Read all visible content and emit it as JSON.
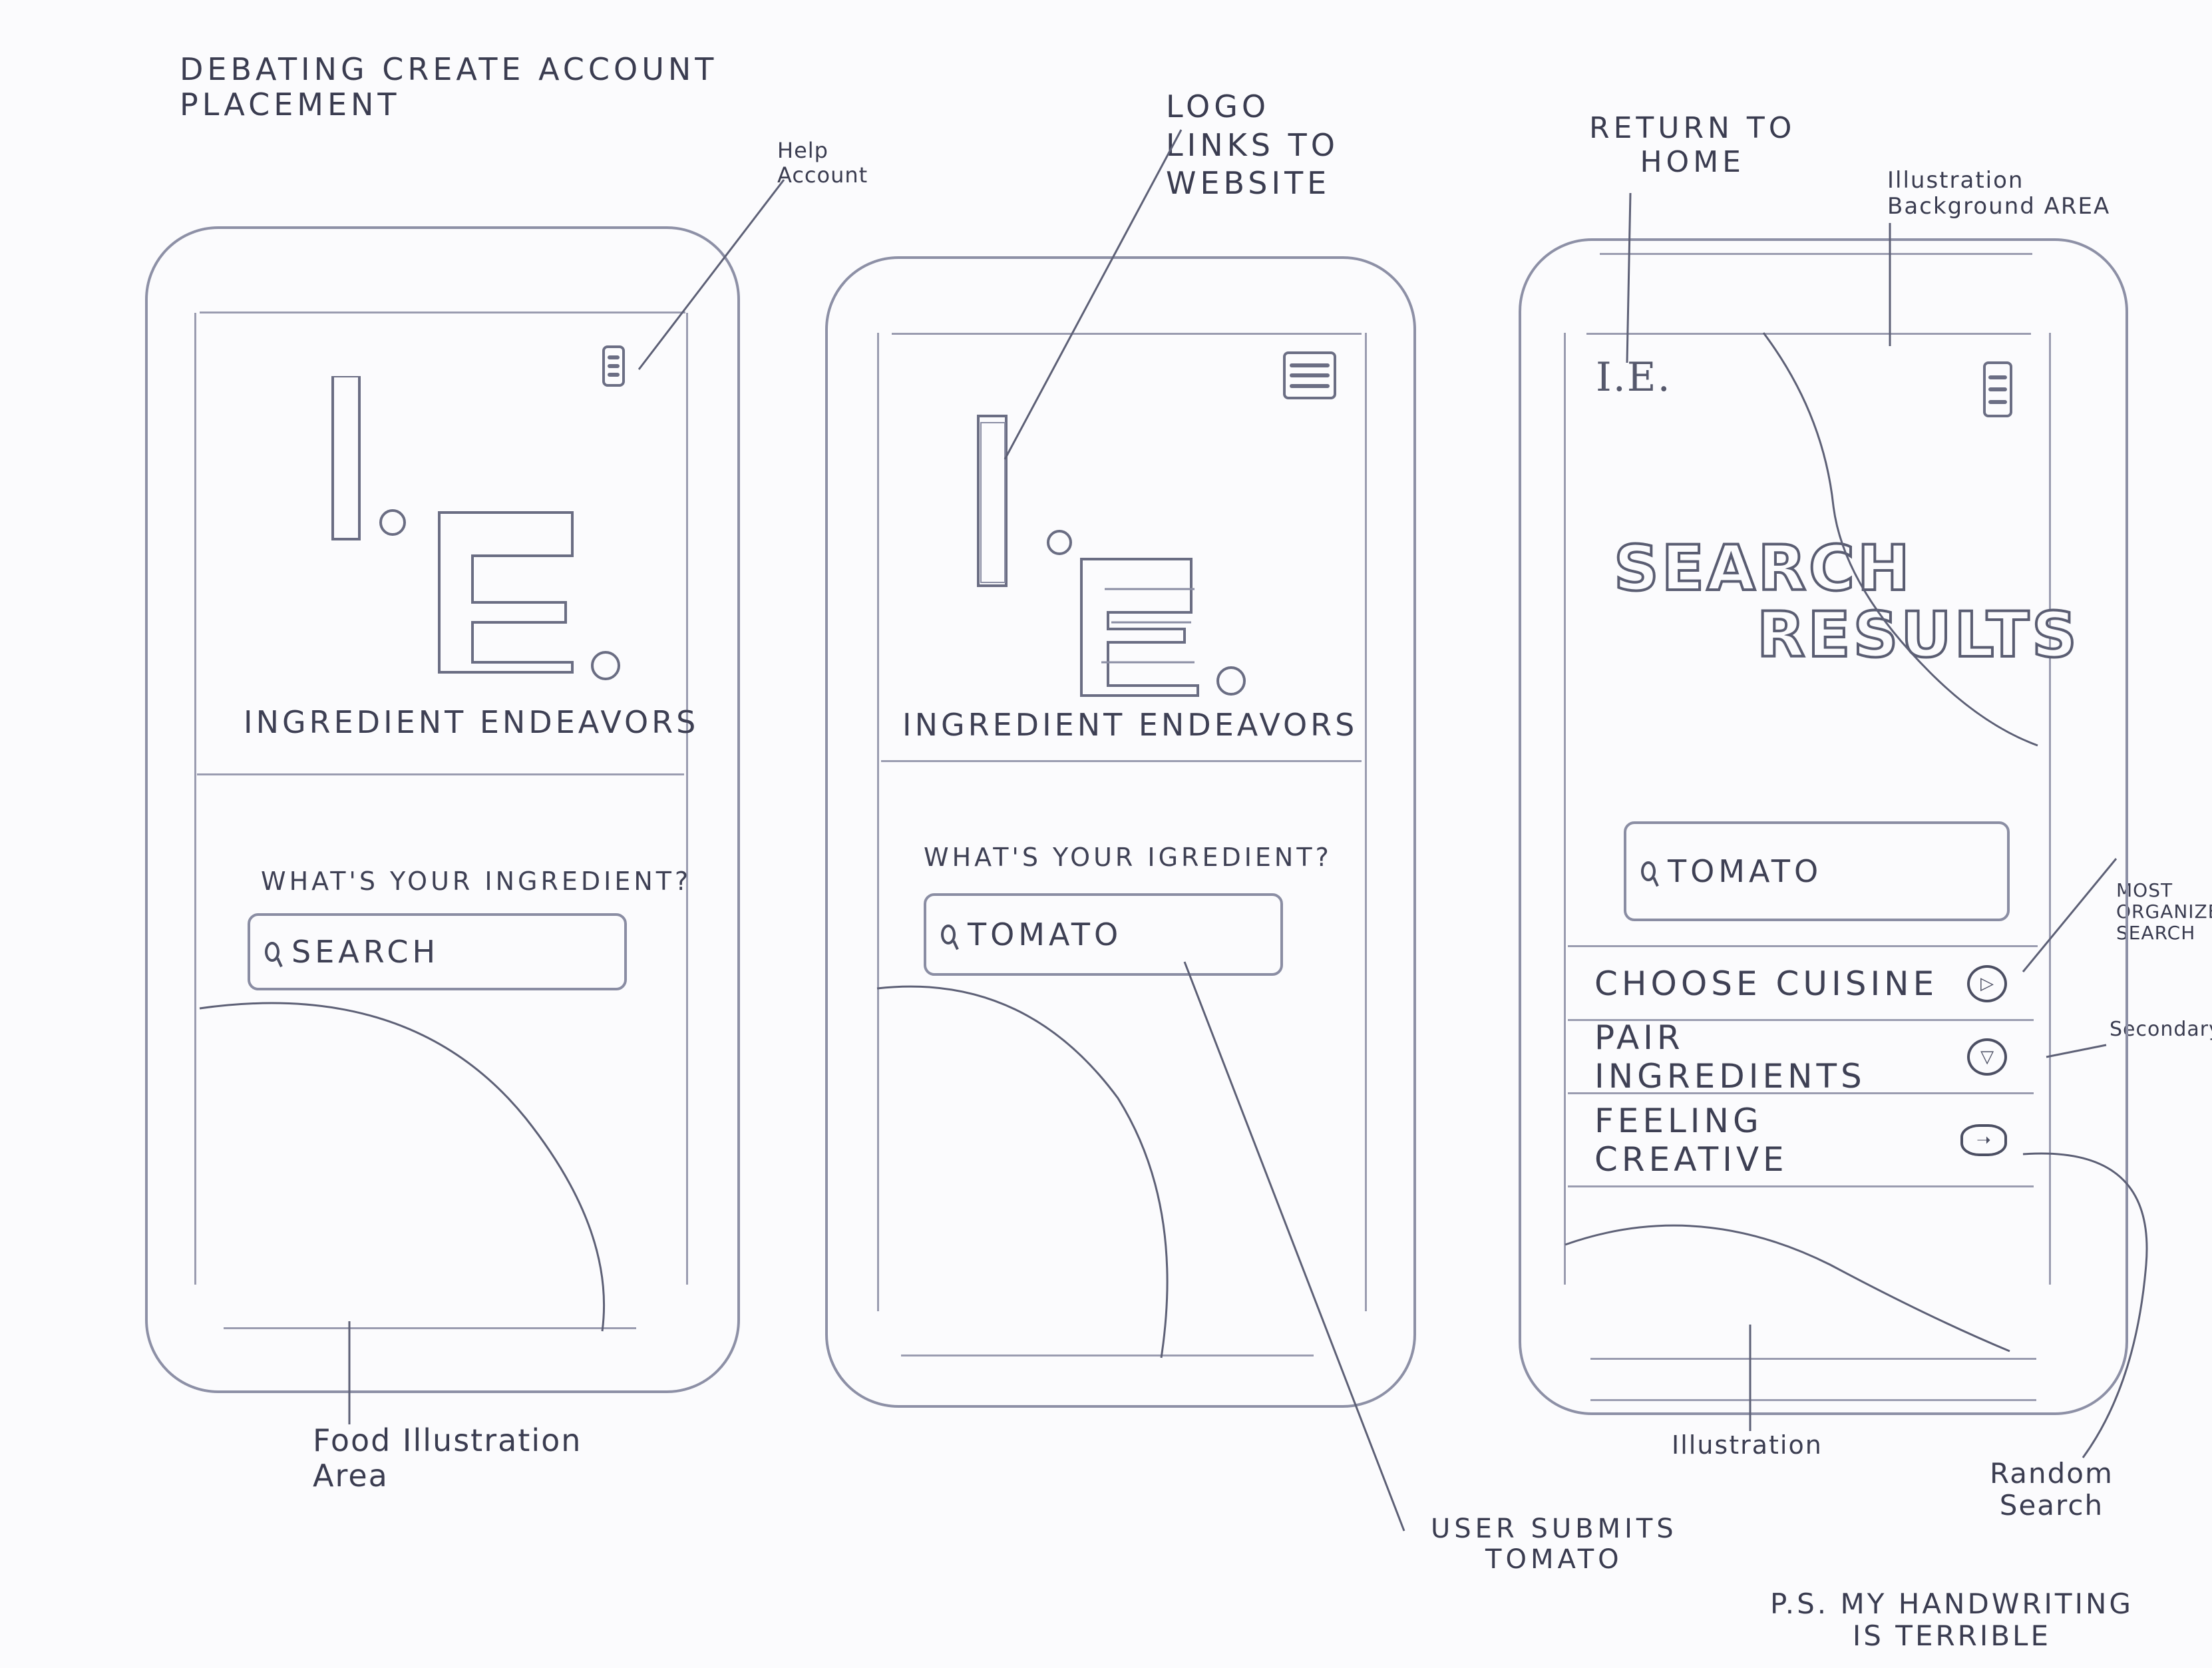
{
  "annotations": {
    "create_account": "DEBATING CREATE ACCOUNT\nPLACEMENT",
    "help_account": "Help\nAccount",
    "logo_links": "LOGO\nLINKS TO\nWEBSITE",
    "return_home": "RETURN TO\nHOME",
    "illustration_background": "Illustration\nBackground AREA",
    "food_illustration": "Food Illustration\nArea",
    "user_submits": "USER SUBMITS\nTOMATO",
    "most_organized": "MOST\nORGANIZED\nSEARCH",
    "secondary": "Secondary",
    "illustration": "Illustration",
    "random_search": "Random\nSearch",
    "ps_note": "P.S. MY HANDWRITING\nIS TERRIBLE"
  },
  "screen1": {
    "logo_text": "INGREDIENT ENDEAVORS",
    "prompt": "WHAT'S YOUR INGREDIENT?",
    "search_placeholder": "SEARCH"
  },
  "screen2": {
    "logo_text": "INGREDIENT ENDEAVORS",
    "prompt": "WHAT'S YOUR IGREDIENT?",
    "search_value": "TOMATO"
  },
  "screen3": {
    "header_logo": "I.E.",
    "title_line1": "SEARCH",
    "title_line2": "RESULTS",
    "search_value": "TOMATO",
    "options": [
      {
        "label": "CHOOSE CUISINE",
        "icon": "play-icon"
      },
      {
        "label": "PAIR INGREDIENTS",
        "icon": "down-arrow-icon"
      },
      {
        "label": "FEELING CREATIVE",
        "icon": "right-arrow-icon"
      }
    ]
  }
}
